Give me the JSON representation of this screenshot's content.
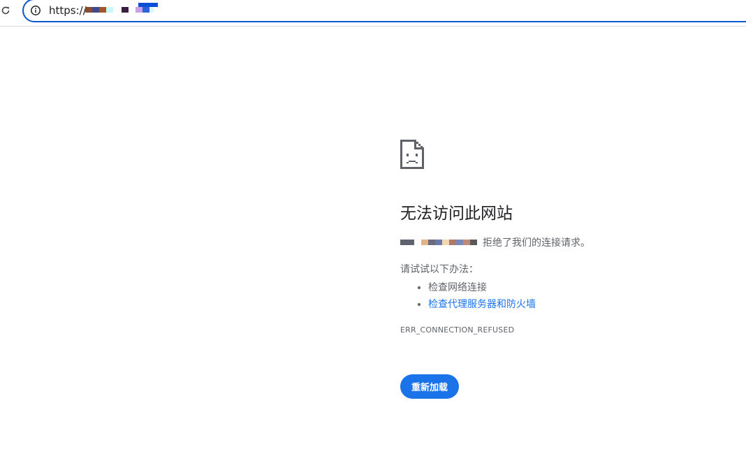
{
  "toolbar": {
    "reload_icon": "reload-icon",
    "info_icon": "info-icon"
  },
  "address_bar": {
    "url_prefix": "https://"
  },
  "error": {
    "icon": "sad-page-icon",
    "title": "无法访问此网站",
    "description_suffix": "拒绝了我们的连接请求。",
    "try_title": "请试试以下办法：",
    "suggestions": [
      {
        "label": "检查网络连接",
        "is_link": false
      },
      {
        "label": "检查代理服务器和防火墙",
        "is_link": true
      }
    ],
    "error_code": "ERR_CONNECTION_REFUSED",
    "reload_label": "重新加载"
  },
  "colors": {
    "accent": "#1a73e8",
    "omnibox_border": "#0b57d0",
    "text_secondary": "#5f6368"
  }
}
